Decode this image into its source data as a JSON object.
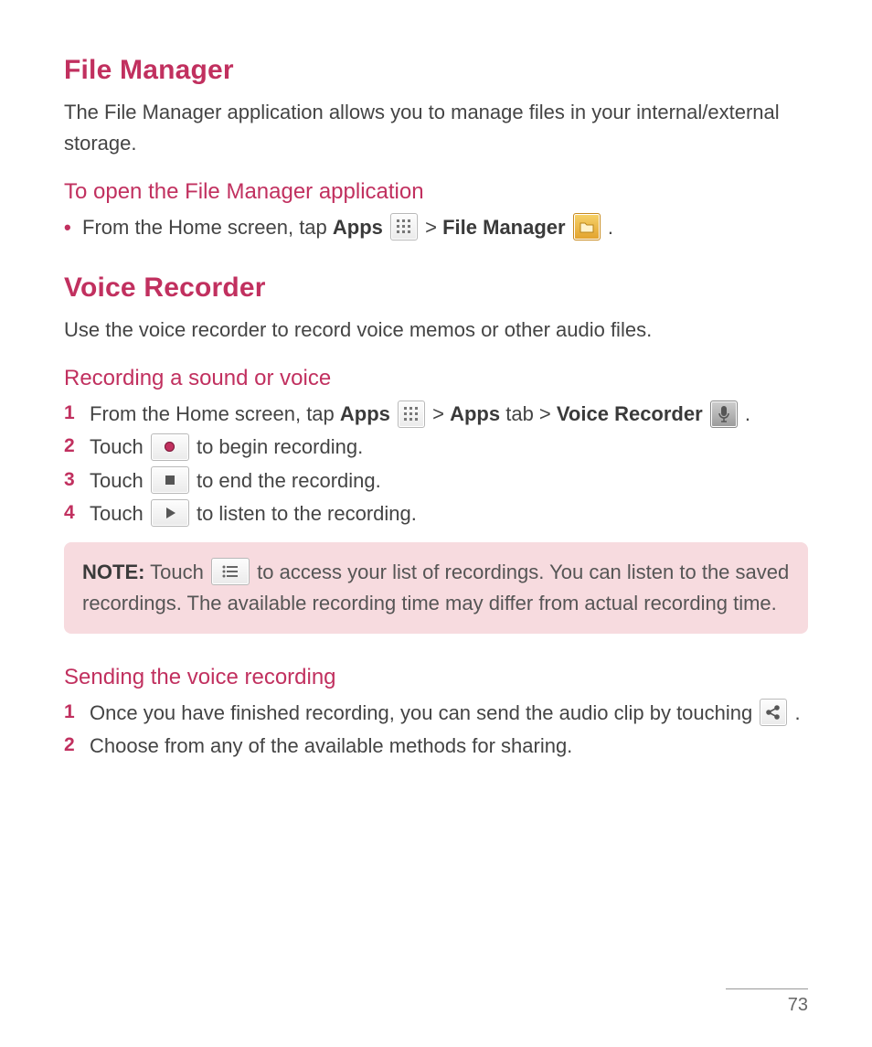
{
  "sections": {
    "fileManager": {
      "title": "File Manager",
      "intro": "The File Manager application allows you to manage files in your internal/external storage.",
      "subTitle": "To open the File Manager application",
      "step": {
        "prefix": "From the Home screen, tap ",
        "apps": "Apps",
        "gt1": " > ",
        "fm": "File Manager",
        "period": " ."
      }
    },
    "voiceRecorder": {
      "title": "Voice Recorder",
      "intro": "Use the voice recorder to record voice memos or other audio files.",
      "recordSub": "Recording a sound or voice",
      "steps": {
        "s1_prefix": "From the Home screen, tap ",
        "s1_apps": "Apps",
        "s1_mid": " > ",
        "s1_appsTab": "Apps",
        "s1_tabWord": " tab > ",
        "s1_vr": "Voice Recorder",
        "s1_end": " .",
        "s2_a": "Touch ",
        "s2_b": " to begin recording.",
        "s3_a": "Touch ",
        "s3_b": " to end the recording.",
        "s4_a": "Touch ",
        "s4_b": " to listen to the recording."
      },
      "note": {
        "label": "NOTE:",
        "a": " Touch ",
        "b": " to access your list of recordings. You can listen to the saved recordings. The available recording time may differ from actual recording time."
      },
      "sendSub": "Sending the voice recording",
      "send": {
        "s1_a": "Once you have finished recording, you can send the audio clip by touching ",
        "s1_b": " .",
        "s2": "Choose from any of the available methods for sharing."
      }
    }
  },
  "nums": {
    "n1": "1",
    "n2": "2",
    "n3": "3",
    "n4": "4"
  },
  "pageNumber": "73"
}
